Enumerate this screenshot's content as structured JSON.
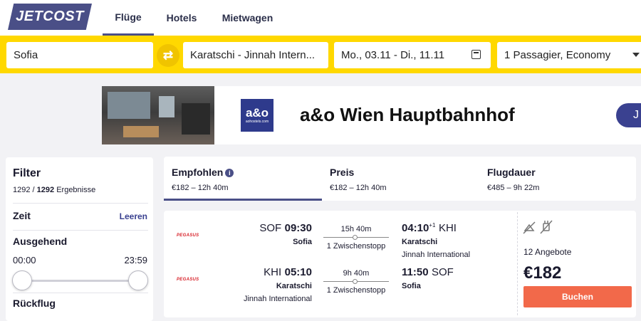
{
  "header": {
    "logo": "JETCOST",
    "tabs": [
      {
        "label": "Flüge",
        "active": true
      },
      {
        "label": "Hotels",
        "active": false
      },
      {
        "label": "Mietwagen",
        "active": false
      }
    ]
  },
  "search": {
    "origin": "Sofia",
    "destination": "Karatschi - Jinnah Intern...",
    "dates": "Mo., 03.11 - Di., 11.11",
    "passengers": "1 Passagier, Economy"
  },
  "ad": {
    "logo_main": "a&o",
    "logo_sub": "aohostels.com",
    "title": "a&o Wien Hauptbahnhof",
    "button_label": "J"
  },
  "filter": {
    "title": "Filter",
    "count_shown": "1292",
    "count_separator": " / ",
    "count_total": "1292",
    "count_suffix": " Ergebnisse",
    "section_time": "Zeit",
    "reset_label": "Leeren",
    "outbound_label": "Ausgehend",
    "time_from": "00:00",
    "time_to": "23:59",
    "return_label": "Rückflug"
  },
  "sort": {
    "tabs": [
      {
        "label": "Empfohlen",
        "sub": "€182 – 12h 40m",
        "active": true
      },
      {
        "label": "Preis",
        "sub": "€182 – 12h 40m",
        "active": false
      },
      {
        "label": "Flugdauer",
        "sub": "€485 – 9h 22m",
        "active": false
      }
    ]
  },
  "result": {
    "legs": [
      {
        "airline": "PEGASUS",
        "dep_code": "SOF",
        "dep_time": "09:30",
        "dep_city": "Sofia",
        "dep_airport": "",
        "duration": "15h 40m",
        "stops": "1 Zwischenstopp",
        "arr_time": "04:10",
        "arr_day_offset": "+1",
        "arr_code": "KHI",
        "arr_city": "Karatschi",
        "arr_airport": "Jinnah International"
      },
      {
        "airline": "PEGASUS",
        "dep_code": "KHI",
        "dep_time": "05:10",
        "dep_city": "Karatschi",
        "dep_airport": "Jinnah International",
        "duration": "9h 40m",
        "stops": "1 Zwischenstopp",
        "arr_time": "11:50",
        "arr_day_offset": "",
        "arr_code": "SOF",
        "arr_city": "Sofia",
        "arr_airport": ""
      }
    ],
    "offers": "12 Angebote",
    "price": "€182",
    "book_label": "Buchen"
  },
  "colors": {
    "brand": "#4a4f87",
    "search_bar": "#ffd800",
    "cta": "#f2694a",
    "airline_red": "#d8222a"
  }
}
